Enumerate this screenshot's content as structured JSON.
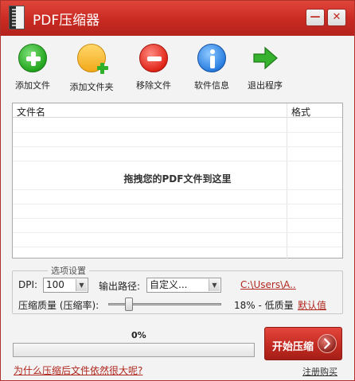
{
  "window": {
    "title": "PDF压缩器",
    "minimize_label": "—",
    "close_label": "✕"
  },
  "toolbar": {
    "items": [
      {
        "label": "添加文件",
        "icon": "add-file-icon"
      },
      {
        "label": "添加文件夹",
        "icon": "add-folder-icon"
      },
      {
        "label": "移除文件",
        "icon": "remove-file-icon"
      },
      {
        "label": "软件信息",
        "icon": "info-icon"
      },
      {
        "label": "退出程序",
        "icon": "exit-arrow-icon"
      }
    ]
  },
  "file_list": {
    "columns": [
      "文件名",
      "格式"
    ],
    "drop_hint": "拖拽您的PDF文件到这里",
    "rows": []
  },
  "options": {
    "legend": "选项设置",
    "dpi_label": "DPI:",
    "dpi_value": "100",
    "output_label": "输出路径:",
    "output_value": "自定义...",
    "output_path_link": "C:\\Users\\A..",
    "quality_label": "压缩质量 (压缩率):",
    "quality_text": "18% - 低质量",
    "quality_level": 0.18,
    "default_link": "默认值"
  },
  "progress": {
    "text": "0%",
    "value": 0
  },
  "start_button": {
    "label": "开始压缩"
  },
  "footer": {
    "help_link": "为什么压缩后文件依然很大呢?",
    "register_link": "注册购买"
  },
  "colors": {
    "brand_red": "#c82a22",
    "link_red": "#b0271f"
  }
}
